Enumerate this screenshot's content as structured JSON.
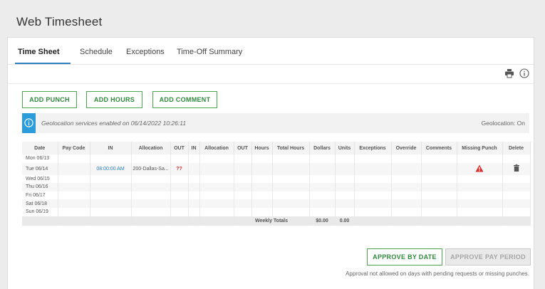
{
  "page": {
    "title": "Web Timesheet"
  },
  "tabs": [
    {
      "label": "Time Sheet",
      "active": true
    },
    {
      "label": "Schedule"
    },
    {
      "label": "Exceptions"
    },
    {
      "label": "Time-Off Summary"
    }
  ],
  "toolbar": {
    "print_icon": "printer-icon",
    "info_icon": "info-icon"
  },
  "actions": {
    "add_punch": "ADD PUNCH",
    "add_hours": "ADD HOURS",
    "add_comment": "ADD COMMENT"
  },
  "geolocation": {
    "message": "Geolocation services enabled on 06/14/2022 10:26:11",
    "status": "Geolocation: On",
    "accent": "#2d9cdb"
  },
  "grid": {
    "columns": [
      "Date",
      "Pay Code",
      "IN",
      "Allocation",
      "OUT",
      "IN",
      "Allocation",
      "OUT",
      "Hours",
      "Total Hours",
      "Dollars",
      "Units",
      "Exceptions",
      "Override",
      "Comments",
      "Missing Punch",
      "Delete"
    ],
    "rows": [
      {
        "date": "Mon 06/13"
      },
      {
        "date": "Tue 06/14",
        "in": "08:00:00 AM",
        "allocation": "200-Dallas-Sa...",
        "out": "??"
      },
      {
        "date": "Wed 06/15"
      },
      {
        "date": "Thu 06/16"
      },
      {
        "date": "Fri 06/17"
      },
      {
        "date": "Sat 06/18"
      },
      {
        "date": "Sun 06/19"
      }
    ],
    "totals": {
      "label": "Weekly Totals",
      "dollars": "$0.00",
      "units": "0.00"
    }
  },
  "approval": {
    "approve_by_date": "APPROVE BY DATE",
    "approve_pay_period": "APPROVE PAY PERIOD",
    "note": "Approval not allowed on days with pending requests or missing punches."
  },
  "colors": {
    "accent_green": "#4da44f",
    "tab_blue": "#2f7ebd",
    "warning_red": "#d32f2f"
  }
}
